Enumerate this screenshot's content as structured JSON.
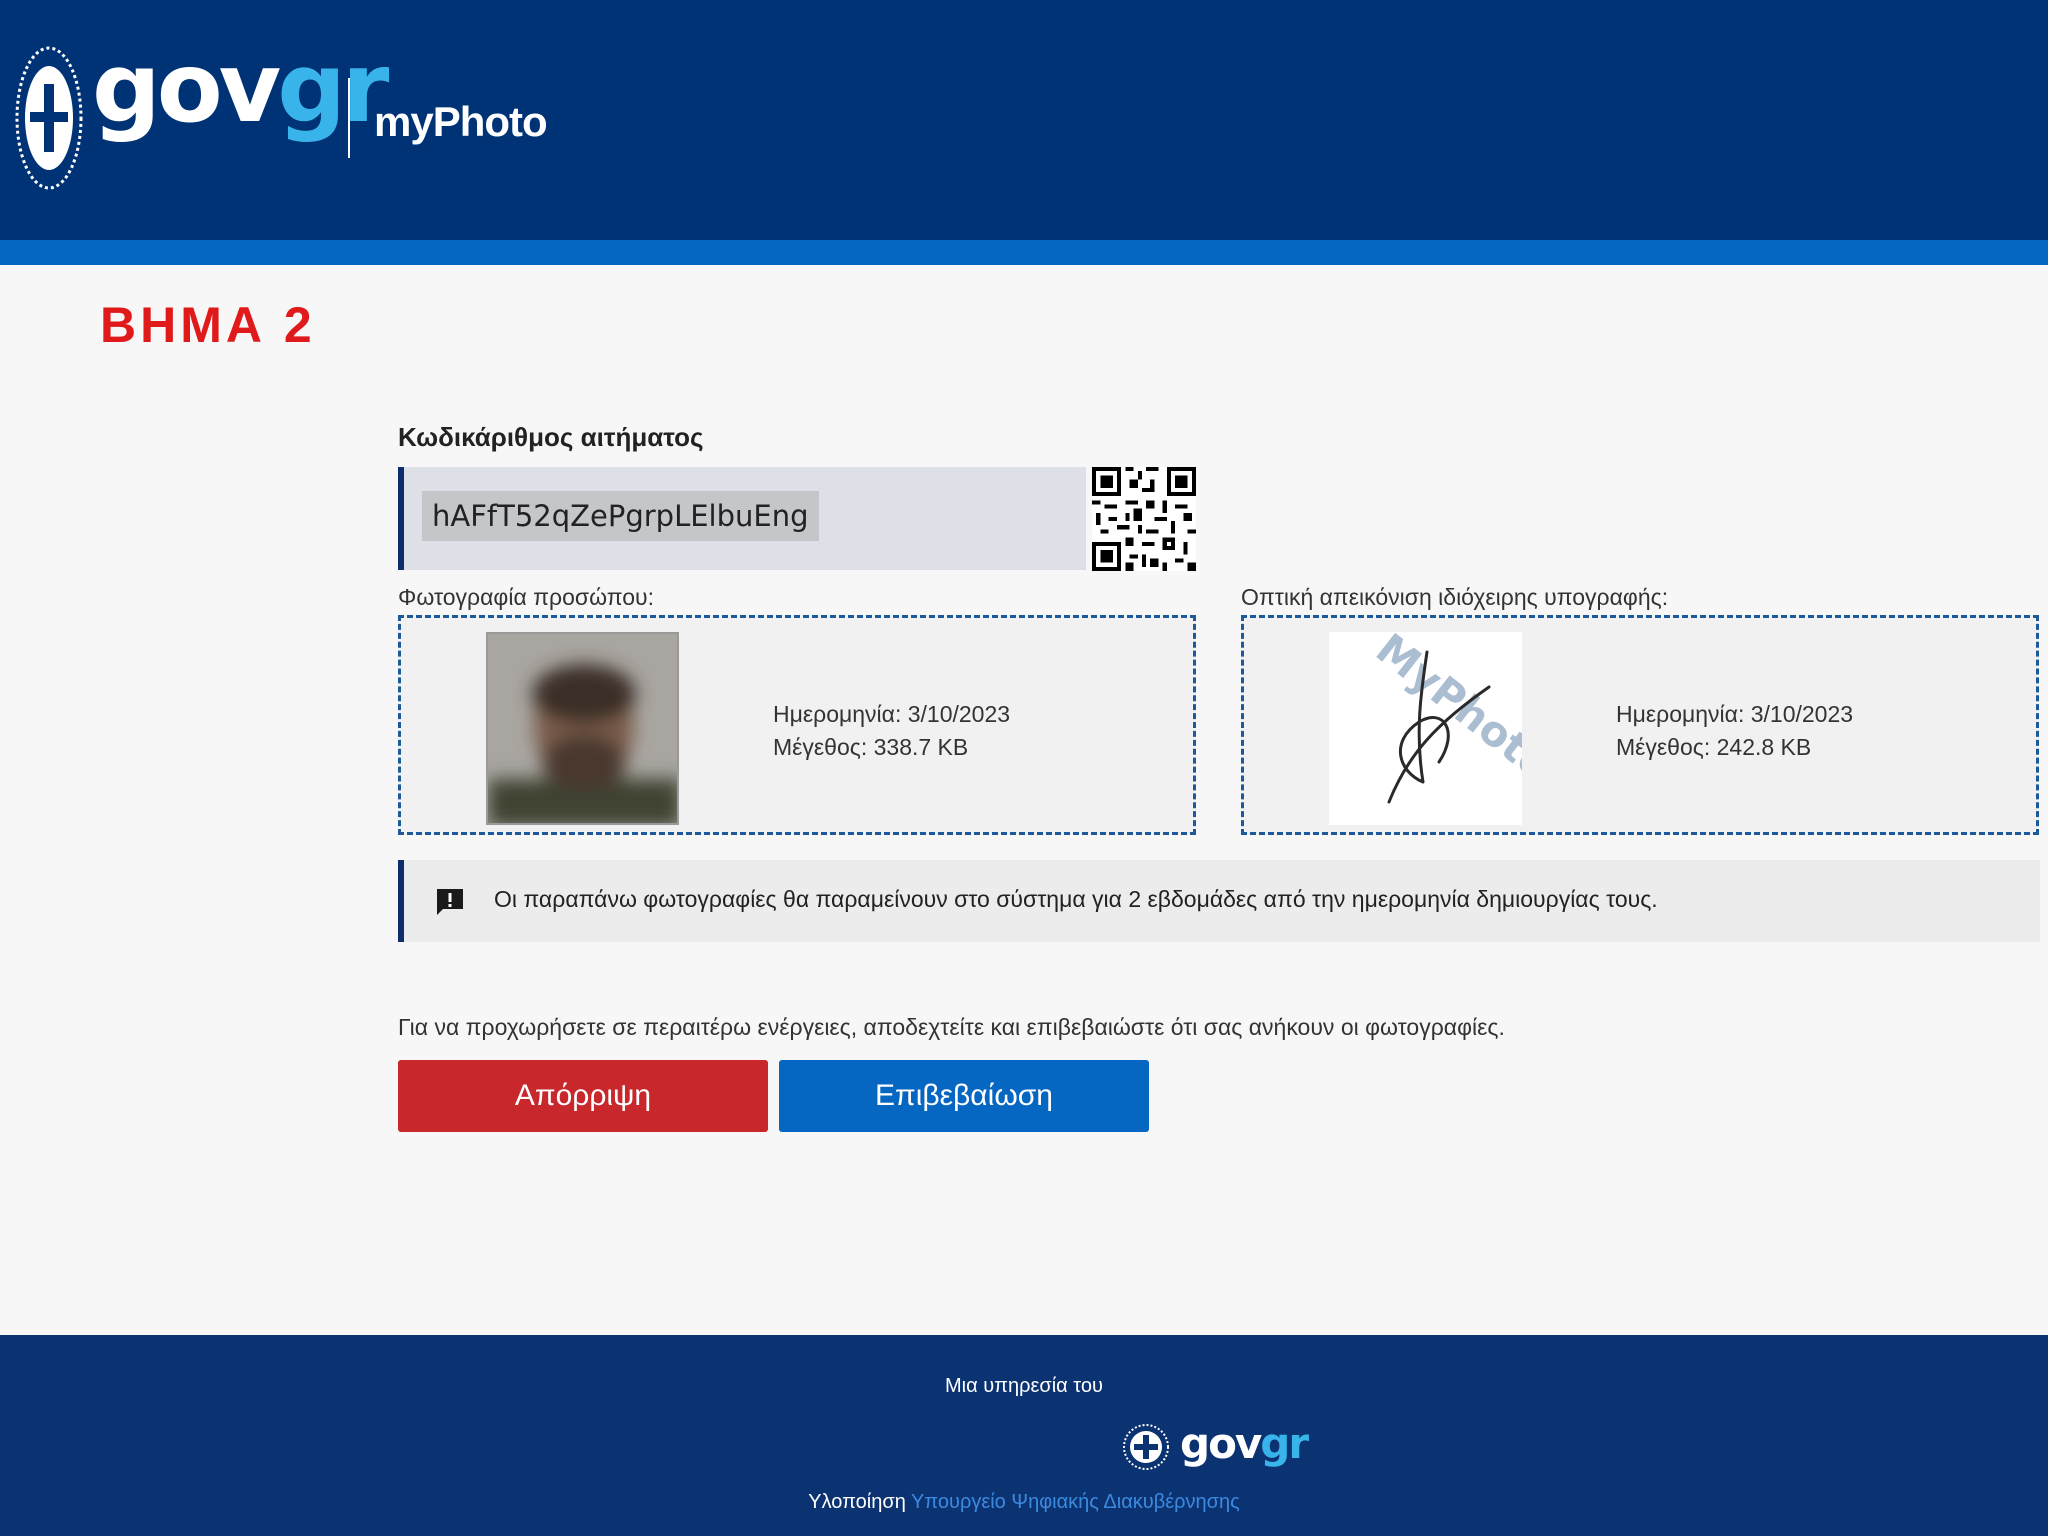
{
  "header": {
    "brand_gov": "gov",
    "brand_gr": "gr",
    "app_name": "myPhoto"
  },
  "step": {
    "label": "ΒΗΜΑ 2"
  },
  "request": {
    "title": "Κωδικάριθμος αιτήματος",
    "code": "hAFfT52qZePgrpLElbuEng"
  },
  "face_photo": {
    "label": "Φωτογραφία προσώπου:",
    "date_text": "Ημερομηνία: 3/10/2023",
    "size_text": "Μέγεθος: 338.7 KB"
  },
  "signature": {
    "label": "Οπτική απεικόνιση ιδιόχειρης υπογραφής:",
    "date_text": "Ημερομηνία: 3/10/2023",
    "size_text": "Μέγεθος: 242.8 KB",
    "watermark": "MyPhoto"
  },
  "notice": {
    "icon": "alert-message-icon",
    "text": "Οι παραπάνω φωτογραφίες θα παραμείνουν στο σύστημα για 2 εβδομάδες από την ημερομηνία δημιουργίας τους."
  },
  "instruction": "Για να προχωρήσετε σε περαιτέρω ενέργειες, αποδεχτείτε και επιβεβαιώστε ότι σας ανήκουν οι φωτογραφίες.",
  "buttons": {
    "reject": "Απόρριψη",
    "confirm": "Επιβεβαίωση"
  },
  "footer": {
    "service_text": "Μια υπηρεσία του",
    "brand_gov": "gov",
    "brand_gr": "gr",
    "impl_label": "Υλοποίηση",
    "impl_link": "Υπουργείο Ψηφιακής Διακυβέρνησης"
  },
  "colors": {
    "header_bg": "#003375",
    "header_stripe": "#0567c2",
    "step_red": "#e0191a",
    "reject": "#c8272c",
    "confirm": "#0567c2",
    "footer_bg": "#0b3372"
  }
}
